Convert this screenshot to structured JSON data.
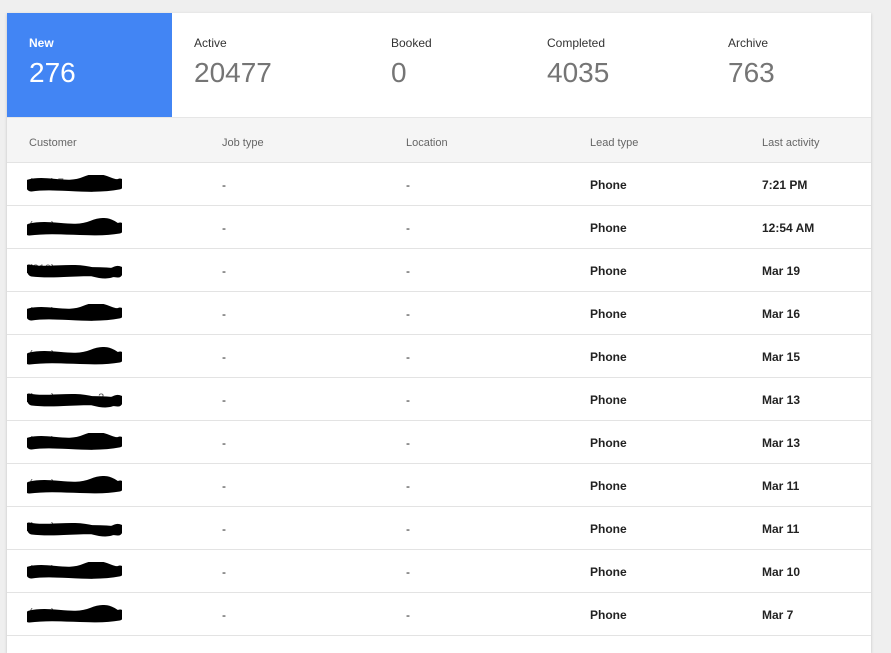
{
  "tabs": [
    {
      "label": "New",
      "count": "276",
      "active": true
    },
    {
      "label": "Active",
      "count": "20477",
      "active": false
    },
    {
      "label": "Booked",
      "count": "0",
      "active": false
    },
    {
      "label": "Completed",
      "count": "4035",
      "active": false
    },
    {
      "label": "Archive",
      "count": "763",
      "active": false
    }
  ],
  "table": {
    "headers": [
      "Customer",
      "Job type",
      "Location",
      "Lead type",
      "Last activity"
    ],
    "rows": [
      {
        "customer": "(7__) 7__-____",
        "job_type": "-",
        "location": "-",
        "lead_type": "Phone",
        "last_activity": "7:21 PM"
      },
      {
        "customer": "(___) ___-____",
        "job_type": "-",
        "location": "-",
        "lead_type": "Phone",
        "last_activity": "12:54 AM"
      },
      {
        "customer": "(310) ___-____",
        "job_type": "-",
        "location": "-",
        "lead_type": "Phone",
        "last_activity": "Mar 19"
      },
      {
        "customer": "(___) ___-____",
        "job_type": "-",
        "location": "-",
        "lead_type": "Phone",
        "last_activity": "Mar 16"
      },
      {
        "customer": "(___) ___-____",
        "job_type": "-",
        "location": "-",
        "lead_type": "Phone",
        "last_activity": "Mar 15"
      },
      {
        "customer": "(___) ___-___2",
        "job_type": "-",
        "location": "-",
        "lead_type": "Phone",
        "last_activity": "Mar 13"
      },
      {
        "customer": "(___) ___-____",
        "job_type": "-",
        "location": "-",
        "lead_type": "Phone",
        "last_activity": "Mar 13"
      },
      {
        "customer": "(___) ___-____",
        "job_type": "-",
        "location": "-",
        "lead_type": "Phone",
        "last_activity": "Mar 11"
      },
      {
        "customer": "(___) ___-____",
        "job_type": "-",
        "location": "-",
        "lead_type": "Phone",
        "last_activity": "Mar 11"
      },
      {
        "customer": "(___) ___-____",
        "job_type": "-",
        "location": "-",
        "lead_type": "Phone",
        "last_activity": "Mar 10"
      },
      {
        "customer": "(___) ___-____",
        "job_type": "-",
        "location": "-",
        "lead_type": "Phone",
        "last_activity": "Mar 7"
      }
    ]
  },
  "colors": {
    "accent": "#4285f4",
    "redaction": "#000000"
  }
}
